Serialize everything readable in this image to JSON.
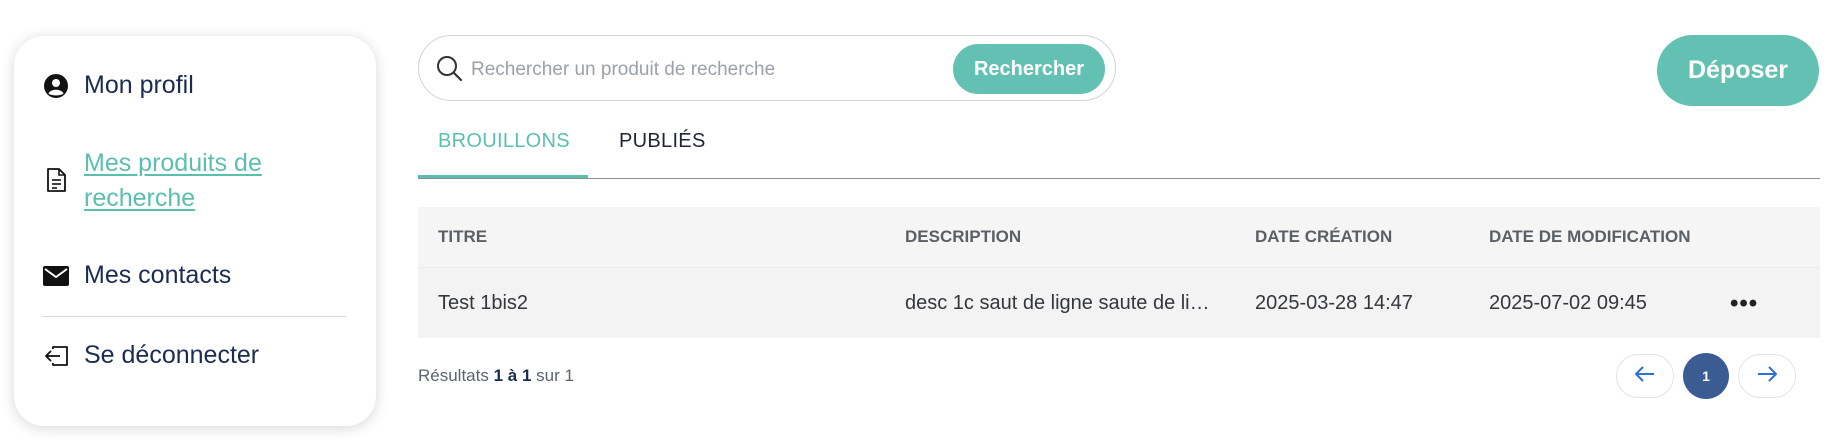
{
  "sidebar": {
    "items": [
      {
        "label": "Mon profil",
        "icon": "user-circle-icon"
      },
      {
        "label": "Mes produits de recherche",
        "icon": "document-icon",
        "active": true
      },
      {
        "label": "Mes contacts",
        "icon": "envelope-icon"
      },
      {
        "label": "Se déconnecter",
        "icon": "logout-icon"
      }
    ]
  },
  "search": {
    "placeholder": "Rechercher un produit de recherche",
    "value": "",
    "button_label": "Rechercher"
  },
  "header": {
    "deposit_label": "Déposer"
  },
  "tabs": [
    {
      "label": "BROUILLONS",
      "active": true
    },
    {
      "label": "PUBLIÉS",
      "active": false
    }
  ],
  "table": {
    "columns": [
      "TITRE",
      "DESCRIPTION",
      "DATE CRÉATION",
      "DATE DE MODIFICATION"
    ],
    "rows": [
      {
        "titre": "Test 1bis2",
        "description": "desc 1c saut de ligne saute de li…",
        "date_creation": "2025-03-28 14:47",
        "date_modification": "2025-07-02 09:45",
        "actions": "•••"
      }
    ]
  },
  "results": {
    "prefix": "Résultats",
    "range": "1 à 1",
    "suffix": "sur 1"
  },
  "pagination": {
    "current": "1"
  },
  "colors": {
    "accent": "#63c1b3",
    "navy": "#1b2c52",
    "page_active": "#3a5c92"
  }
}
